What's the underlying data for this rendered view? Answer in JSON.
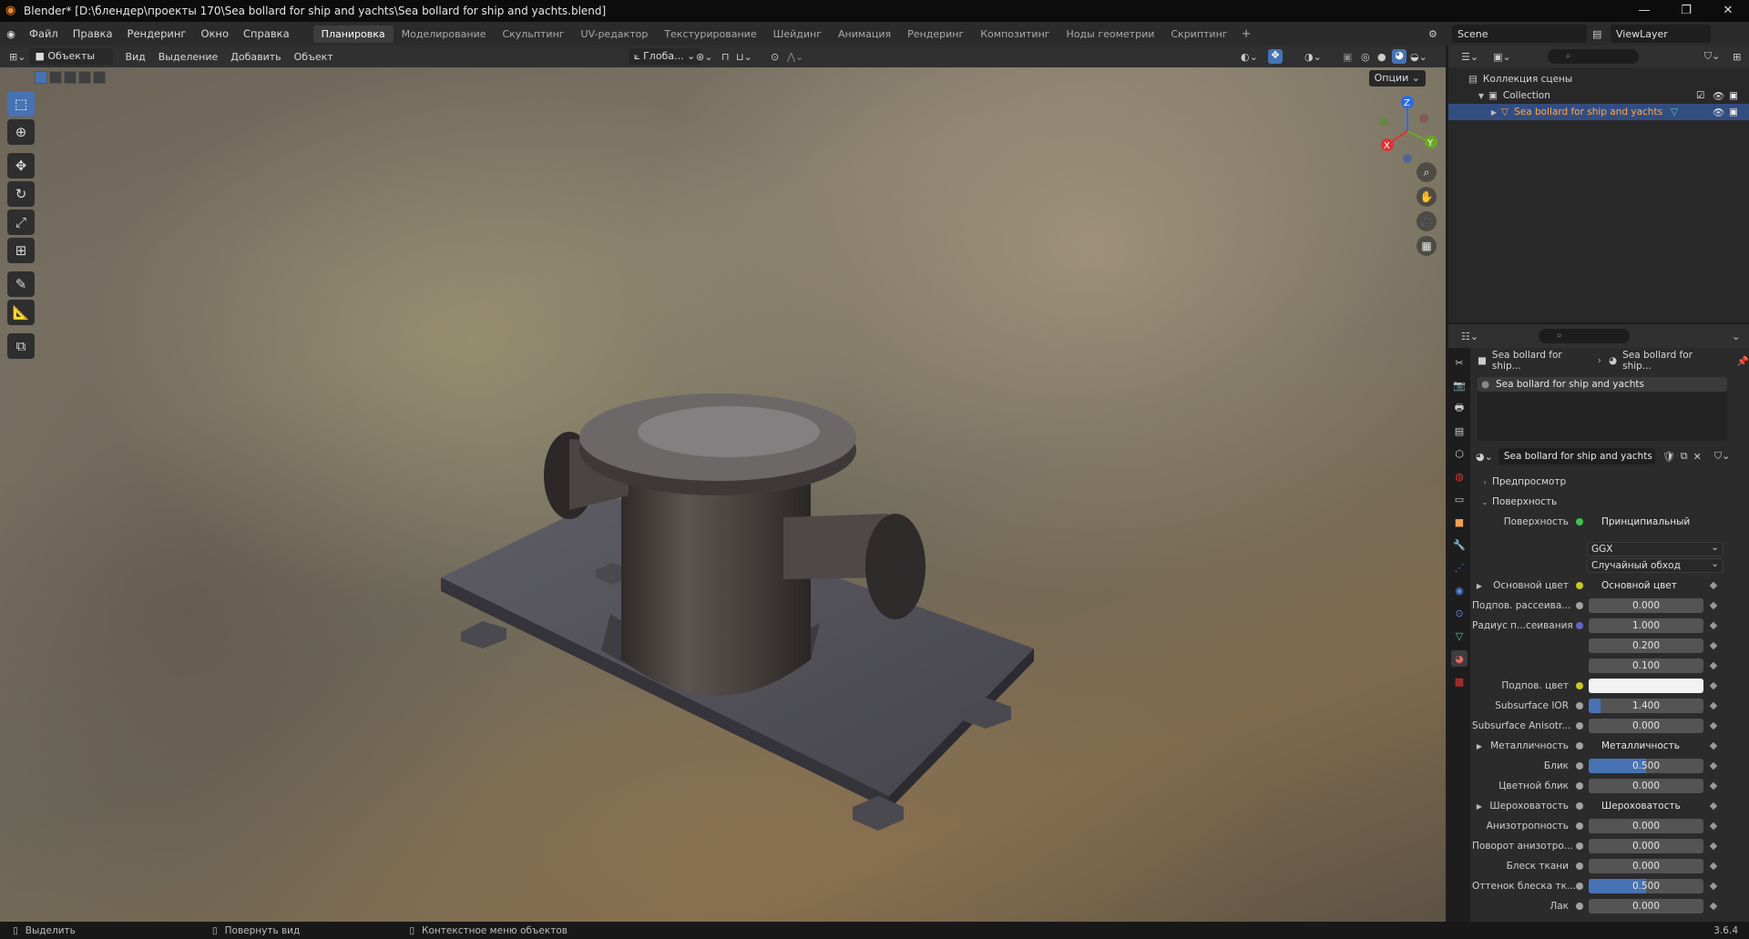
{
  "window": {
    "title": "Blender* [D:\\блендер\\проекты 170\\Sea bollard for ship and yachts\\Sea bollard for ship and yachts.blend]",
    "minimize": "—",
    "restore": "❐",
    "close": "✕"
  },
  "menu": [
    "Файл",
    "Правка",
    "Рендеринг",
    "Окно",
    "Справка"
  ],
  "workspaces": [
    {
      "label": "Планировка",
      "active": true
    },
    {
      "label": "Моделирование"
    },
    {
      "label": "Скульптинг"
    },
    {
      "label": "UV-редактор"
    },
    {
      "label": "Текстурирование"
    },
    {
      "label": "Шейдинг"
    },
    {
      "label": "Анимация"
    },
    {
      "label": "Рендеринг"
    },
    {
      "label": "Композитинг"
    },
    {
      "label": "Ноды геометрии"
    },
    {
      "label": "Скриптинг"
    }
  ],
  "add_workspace": "+",
  "scene": {
    "name": "Scene",
    "view_layer": "ViewLayer"
  },
  "viewport_header": {
    "mode": "Объекты",
    "menus": [
      "Вид",
      "Выделение",
      "Добавить",
      "Объект"
    ],
    "transform_orientation": "Глоба...",
    "options": "Опции"
  },
  "outliner": {
    "root": "Коллекция сцены",
    "collection": "Collection",
    "object": "Sea bollard for ship and yachts"
  },
  "properties": {
    "breadcrumb_object": "Sea bollard for ship...",
    "breadcrumb_material": "Sea bollard for ship...",
    "material_slot": "Sea bollard for ship and yachts",
    "material_name": "Sea bollard for ship and yachts",
    "panels": {
      "preview": "Предпросмотр",
      "surface": "Поверхность"
    },
    "surface_label": "Поверхность",
    "surface_value": "Принципиальный BSDF",
    "distribution": "GGX",
    "subsurface_method": "Случайный обход",
    "fields": [
      {
        "label": "Основной цвет",
        "value": "Основной цвет",
        "type": "link",
        "dot": "#c7c729",
        "expand": true
      },
      {
        "label": "Подпов. рассеива...",
        "value": "0.000",
        "type": "num",
        "dot": "#a1a1a1",
        "fill": 0
      },
      {
        "label": "Радиус п...сеивания",
        "value": "1.000",
        "type": "num",
        "dot": "#6363c7",
        "fill": 0
      },
      {
        "label": "",
        "value": "0.200",
        "type": "num",
        "fill": 0
      },
      {
        "label": "",
        "value": "0.100",
        "type": "num",
        "fill": 0
      },
      {
        "label": "Подпов. цвет",
        "value": "",
        "type": "color",
        "dot": "#c7c729",
        "color": "#f2f2f2"
      },
      {
        "label": "Subsurface IOR",
        "value": "1.400",
        "type": "num",
        "dot": "#a1a1a1",
        "fill": 0.1
      },
      {
        "label": "Subsurface Anisotr...",
        "value": "0.000",
        "type": "num",
        "dot": "#a1a1a1",
        "fill": 0
      },
      {
        "label": "Металличность",
        "value": "Металличность",
        "type": "link",
        "dot": "#a1a1a1",
        "expand": true
      },
      {
        "label": "Блик",
        "value": "0.500",
        "type": "num",
        "dot": "#a1a1a1",
        "fill": 0.5
      },
      {
        "label": "Цветной блик",
        "value": "0.000",
        "type": "num",
        "dot": "#a1a1a1",
        "fill": 0
      },
      {
        "label": "Шероховатость",
        "value": "Шероховатость",
        "type": "link",
        "dot": "#a1a1a1",
        "expand": true
      },
      {
        "label": "Анизотропность",
        "value": "0.000",
        "type": "num",
        "dot": "#a1a1a1",
        "fill": 0
      },
      {
        "label": "Поворот анизотро...",
        "value": "0.000",
        "type": "num",
        "dot": "#a1a1a1",
        "fill": 0
      },
      {
        "label": "Блеск ткани",
        "value": "0.000",
        "type": "num",
        "dot": "#a1a1a1",
        "fill": 0
      },
      {
        "label": "Оттенок блеска тк...",
        "value": "0.500",
        "type": "num",
        "dot": "#a1a1a1",
        "fill": 0.5
      },
      {
        "label": "Лак",
        "value": "0.000",
        "type": "num",
        "dot": "#a1a1a1",
        "fill": 0
      }
    ]
  },
  "gizmo": {
    "x": "X",
    "y": "Y",
    "z": "Z"
  },
  "statusbar": {
    "select": "Выделить",
    "rotate": "Повернуть вид",
    "context": "Контекстное меню объектов",
    "version": "3.6.4"
  },
  "colors": {
    "accent": "#4772b3",
    "selected_row": "#334d80"
  }
}
